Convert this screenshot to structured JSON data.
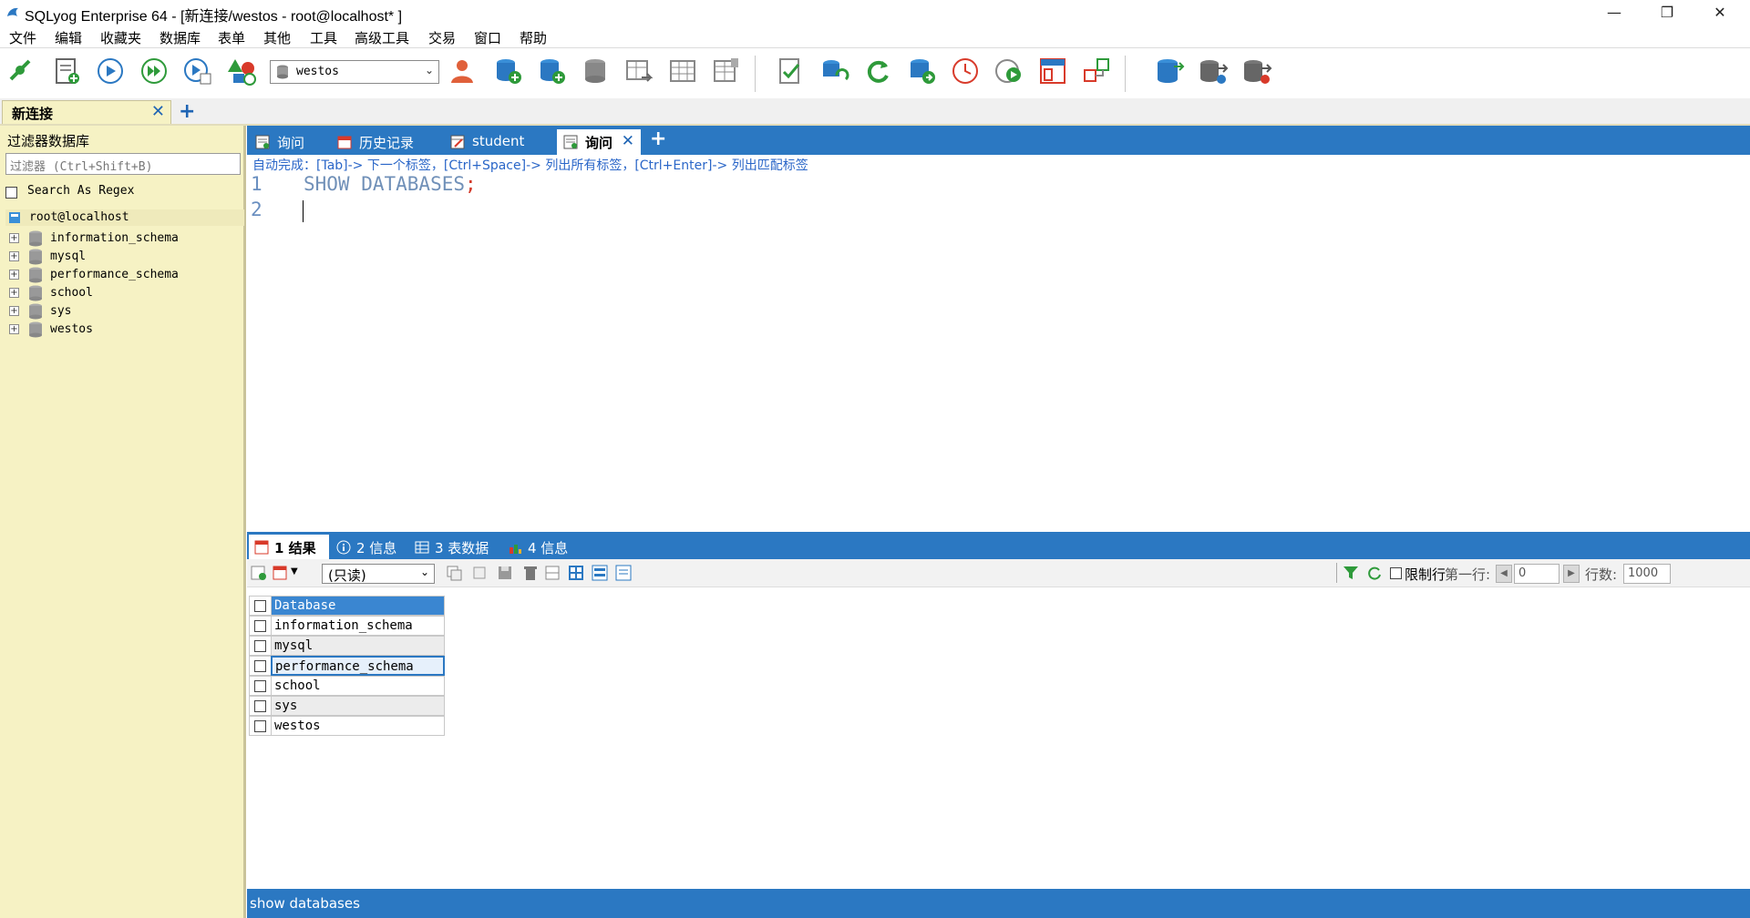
{
  "window": {
    "title": "SQLyog Enterprise 64 - [新连接/westos - root@localhost* ]",
    "controls": [
      "minimize",
      "restore",
      "close"
    ]
  },
  "menu": [
    "文件",
    "编辑",
    "收藏夹",
    "数据库",
    "表单",
    "其他",
    "工具",
    "高级工具",
    "交易",
    "窗口",
    "帮助"
  ],
  "toolbar": {
    "database_select": "westos"
  },
  "connection_tabs": [
    {
      "label": "新连接",
      "active": true
    }
  ],
  "object_browser": {
    "header": "过滤器数据库",
    "filter_placeholder": "过滤器 (Ctrl+Shift+B)",
    "regex_label": "Search As Regex",
    "root": "root@localhost",
    "databases": [
      "information_schema",
      "mysql",
      "performance_schema",
      "school",
      "sys",
      "westos"
    ]
  },
  "query_tabs": [
    {
      "label": "询问",
      "icon": "query-icon",
      "active": false
    },
    {
      "label": "历史记录",
      "icon": "history-icon",
      "active": false
    },
    {
      "label": "student",
      "icon": "table-edit-icon",
      "active": false
    },
    {
      "label": "询问",
      "icon": "query-icon",
      "active": true
    }
  ],
  "editor": {
    "hint": "自动完成：[Tab]-> 下一个标签，[Ctrl+Space]-> 列出所有标签，[Ctrl+Enter]-> 列出匹配标签",
    "line_numbers": [
      "1",
      "2"
    ],
    "code_text": "SHOW DATABASES",
    "code_semicolon": ";"
  },
  "result_tabs": [
    {
      "label": "1 结果",
      "active": true
    },
    {
      "label": "2 信息",
      "active": false
    },
    {
      "label": "3 表数据",
      "active": false
    },
    {
      "label": "4 信息",
      "active": false
    }
  ],
  "result_toolbar": {
    "mode": "(只读)",
    "limit_label": "限制行",
    "first_row_label": "第一行:",
    "first_row_value": "0",
    "rows_label": "行数:",
    "rows_value": "1000"
  },
  "result_grid": {
    "header": "Database",
    "rows": [
      "information_schema",
      "mysql",
      "performance_schema",
      "school",
      "sys",
      "westos"
    ],
    "selected_row": "performance_schema"
  },
  "status": {
    "text": "show databases"
  },
  "colors": {
    "accent_blue": "#2b78c2",
    "panel_yellow": "#f6f2c4",
    "header_cell": "#3a86d1"
  }
}
